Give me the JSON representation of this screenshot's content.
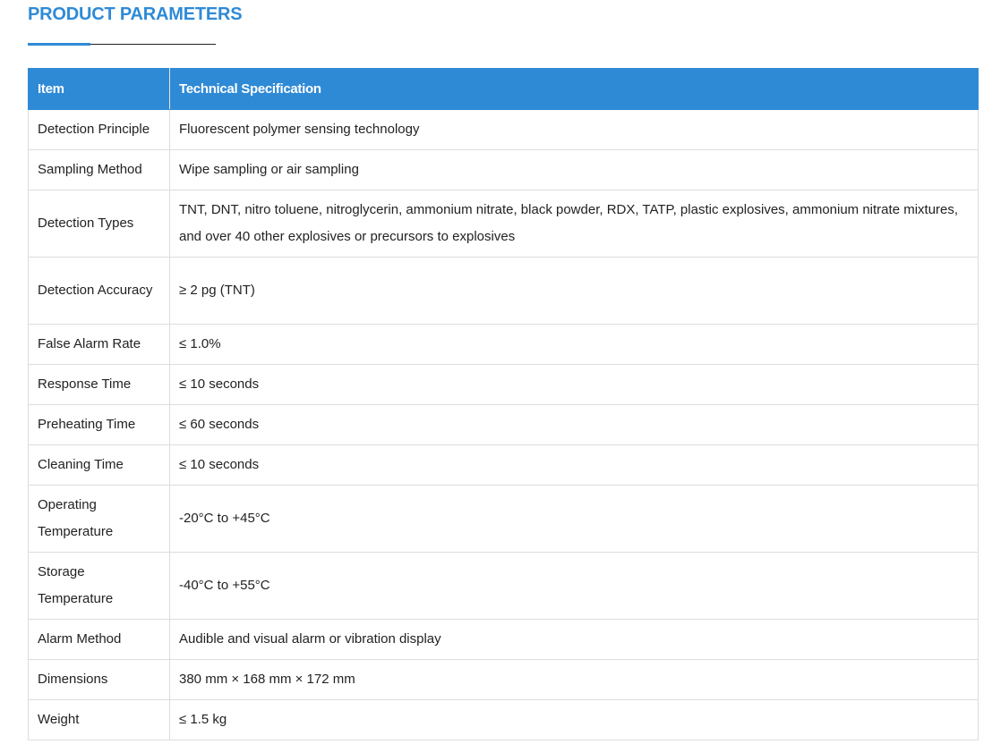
{
  "section": {
    "title": "PRODUCT PARAMETERS"
  },
  "table": {
    "headers": [
      "Item",
      "Technical Specification"
    ],
    "rows": [
      {
        "item": "Detection Principle",
        "spec": "Fluorescent polymer sensing technology"
      },
      {
        "item": "Sampling Method",
        "spec": "Wipe sampling or air sampling"
      },
      {
        "item": "Detection Types",
        "spec": "TNT, DNT, nitro toluene, nitroglycerin, ammonium nitrate, black powder, RDX, TATP, plastic explosives, ammonium nitrate mixtures, and over 40 other explosives or precursors to explosives"
      },
      {
        "item": "Detection Accuracy",
        "spec": "≥ 2 pg (TNT)"
      },
      {
        "item": "False Alarm Rate",
        "spec": "≤ 1.0%"
      },
      {
        "item": "Response Time",
        "spec": "≤ 10 seconds"
      },
      {
        "item": "Preheating Time",
        "spec": "≤ 60 seconds"
      },
      {
        "item": "Cleaning Time",
        "spec": "≤ 10 seconds"
      },
      {
        "item": "Operating Temperature",
        "spec": "-20°C to +45°C"
      },
      {
        "item": "Storage Temperature",
        "spec": "-40°C to +55°C"
      },
      {
        "item": "Alarm Method",
        "spec": "Audible and visual alarm or vibration display"
      },
      {
        "item": "Dimensions",
        "spec": "380 mm × 168 mm × 172 mm"
      },
      {
        "item": "Weight",
        "spec": "≤ 1.5 kg"
      }
    ]
  },
  "colors": {
    "accent": "#2f8ad6",
    "border": "#dddddd",
    "text": "#222222"
  }
}
